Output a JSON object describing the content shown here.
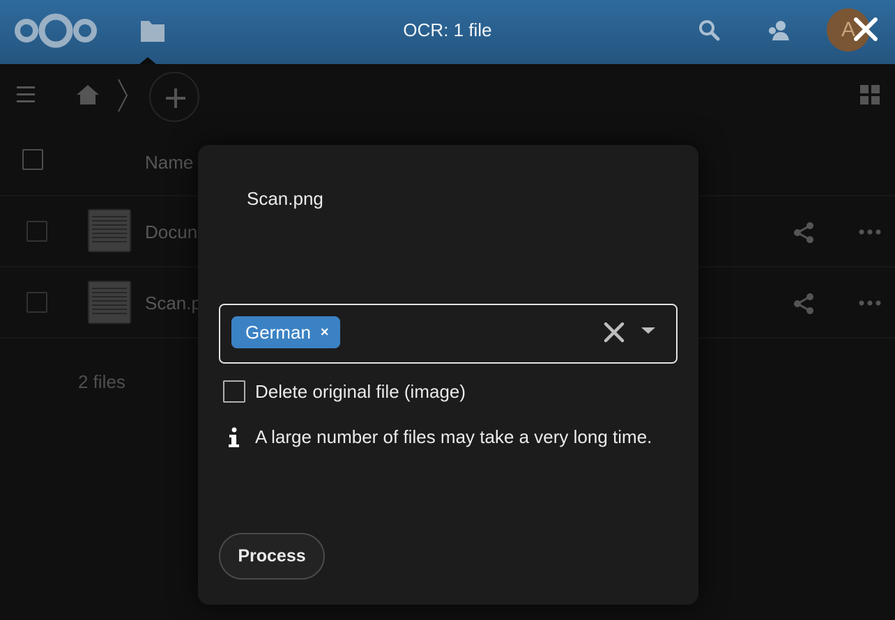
{
  "header": {
    "title": "OCR: 1 file",
    "avatar_initial": "A",
    "icons": [
      "nextcloud-logo",
      "files-folder-icon",
      "search-icon",
      "contacts-icon",
      "close-icon"
    ]
  },
  "files": {
    "column_name": "Name",
    "rows": [
      {
        "name": "Docun"
      },
      {
        "name": "Scan.p"
      }
    ],
    "summary": "2 files"
  },
  "modal": {
    "file_name": "Scan.png",
    "selected_language": "German",
    "tag_remove": "×",
    "delete_original_label": "Delete original file (image)",
    "delete_original_checked": false,
    "info_text": "A large number of files may take a very long time.",
    "process_label": "Process"
  },
  "colors": {
    "header": "#2f6a9d",
    "tag": "#3b82c4",
    "modal_bg": "#1c1c1c"
  }
}
